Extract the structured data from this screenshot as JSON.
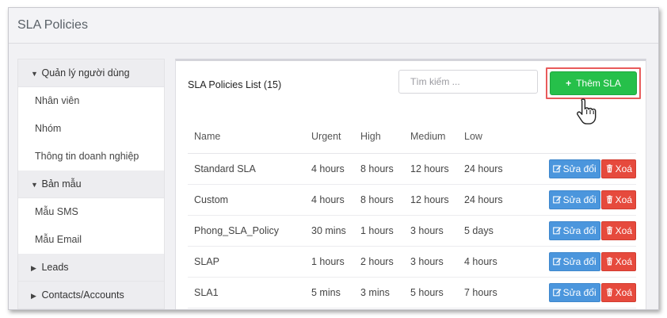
{
  "window": {
    "title": "SLA Policies"
  },
  "sidebar": {
    "groups": [
      {
        "label": "Quản lý người dùng",
        "expanded": true,
        "items": [
          "Nhân viên",
          "Nhóm",
          "Thông tin doanh nghiệp"
        ]
      },
      {
        "label": "Bản mẫu",
        "expanded": true,
        "items": [
          "Mẫu SMS",
          "Mẫu Email"
        ]
      },
      {
        "label": "Leads",
        "expanded": false,
        "items": []
      },
      {
        "label": "Contacts/Accounts",
        "expanded": false,
        "items": []
      }
    ]
  },
  "panel": {
    "title": "SLA Policies List",
    "count": "(15)",
    "search_placeholder": "Tìm kiếm ...",
    "add_label": "Thêm SLA",
    "add_icon": "+"
  },
  "table": {
    "headers": [
      "Name",
      "Urgent",
      "High",
      "Medium",
      "Low"
    ],
    "edit_label": "Sửa đổi",
    "delete_label": "Xoá",
    "rows": [
      {
        "name": "Standard SLA",
        "urgent": "4 hours",
        "high": "8 hours",
        "medium": "12 hours",
        "low": "24 hours"
      },
      {
        "name": "Custom",
        "urgent": "4 hours",
        "high": "8 hours",
        "medium": "12 hours",
        "low": "24 hours"
      },
      {
        "name": "Phong_SLA_Policy",
        "urgent": "30 mins",
        "high": "1 hours",
        "medium": "3 hours",
        "low": "5 days"
      },
      {
        "name": "SLAP",
        "urgent": "1 hours",
        "high": "2 hours",
        "medium": "3 hours",
        "low": "4 hours"
      },
      {
        "name": "SLA1",
        "urgent": "5 mins",
        "high": "3 mins",
        "medium": "5 hours",
        "low": "7 hours"
      }
    ]
  },
  "colors": {
    "accent_green": "#26c04a",
    "edit_blue": "#4b96dd",
    "delete_red": "#e64a3d",
    "link_blue": "#3598c8",
    "highlight_red": "#e85b5b"
  }
}
